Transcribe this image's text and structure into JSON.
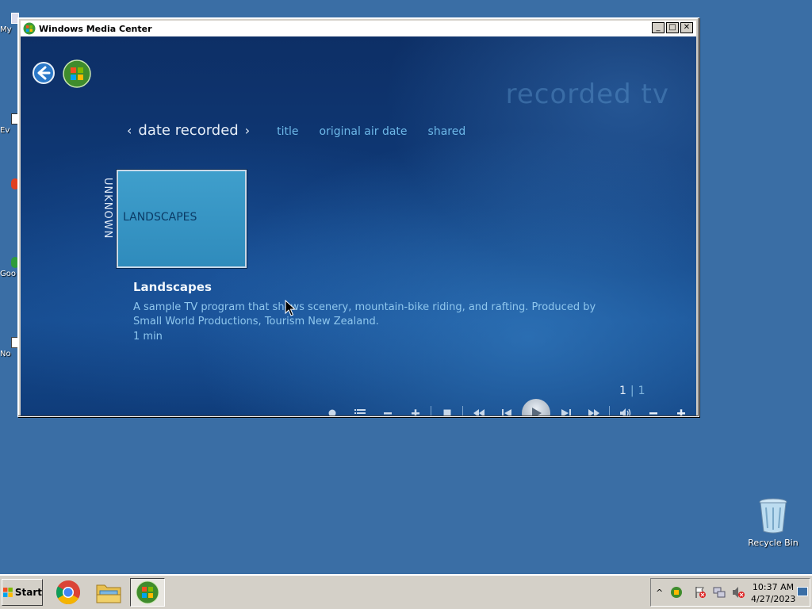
{
  "desktop": {
    "partial_icons": [
      "My",
      "Ev",
      "Goo",
      "No"
    ],
    "recycle_bin_label": "Recycle Bin"
  },
  "window": {
    "title": "Windows Media Center",
    "controls": {
      "minimize": "_",
      "maximize": "□",
      "close": "✕"
    }
  },
  "media_center": {
    "heading": "recorded tv",
    "tabs": {
      "active": "date recorded",
      "others": [
        "title",
        "original air date",
        "shared"
      ]
    },
    "group_label": "UNKNOWN",
    "tile_label": "LANDSCAPES",
    "selected_item": {
      "title": "Landscapes",
      "description": "A sample TV program that shows scenery, mountain-bike riding, and rafting. Produced by Small World Productions, Tourism New Zealand.",
      "duration": "1 min"
    },
    "pager": {
      "current": "1",
      "total": "1"
    },
    "transport_icons": [
      "record-icon",
      "guide-list-icon",
      "channel-down-icon",
      "channel-up-icon",
      "stop-icon",
      "rewind-icon",
      "skip-back-icon",
      "play-icon",
      "skip-forward-icon",
      "fast-forward-icon",
      "volume-icon",
      "volume-down-icon",
      "volume-up-icon"
    ]
  },
  "taskbar": {
    "start_label": "Start",
    "apps": [
      "chrome",
      "file-explorer",
      "windows-media-center"
    ],
    "clock": {
      "time": "10:37 AM",
      "date": "4/27/2023"
    },
    "tray_caret": "^"
  },
  "colors": {
    "desktop": "#3a6ea5",
    "wmc_bg": "#0f3a78",
    "tab_inactive": "#6db8e8",
    "tile": "#3f9fcc"
  }
}
